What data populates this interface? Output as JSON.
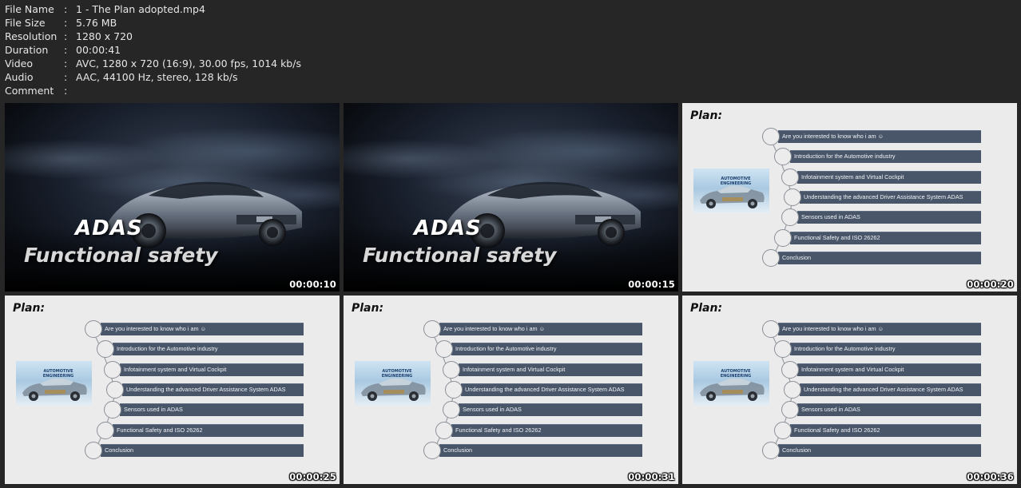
{
  "meta": [
    {
      "key": "File Name",
      "sep": ":",
      "value": "1 - The Plan adopted.mp4"
    },
    {
      "key": "File Size",
      "sep": ":",
      "value": "5.76 MB"
    },
    {
      "key": "Resolution",
      "sep": ":",
      "value": "1280 x 720"
    },
    {
      "key": "Duration",
      "sep": ":",
      "value": "00:00:41"
    },
    {
      "key": "Video",
      "sep": ":",
      "value": "AVC, 1280 x 720 (16:9), 30.00 fps, 1014 kb/s"
    },
    {
      "key": "Audio",
      "sep": ":",
      "value": "AAC, 44100 Hz, stereo, 128 kb/s"
    },
    {
      "key": "Comment",
      "sep": ":",
      "value": ""
    }
  ],
  "title_slide": {
    "line1": "ADAS",
    "line2": "Functional safety"
  },
  "plan_slide": {
    "title": "Plan:",
    "image_text": "AUTOMOTIVE ENGINEERING",
    "items": [
      "Are you interested to know who i am ☺",
      "Introduction for the Automotive industry",
      "Infotainment system and Virtual Cockpit",
      "Understanding the advanced Driver Assistance System ADAS",
      "Sensors used in ADAS",
      "Functional Safety and ISO 26262",
      "Conclusion"
    ]
  },
  "thumbnails": [
    {
      "type": "title",
      "timestamp": "00:00:10"
    },
    {
      "type": "title",
      "timestamp": "00:00:15"
    },
    {
      "type": "plan",
      "timestamp": "00:00:20"
    },
    {
      "type": "plan",
      "timestamp": "00:00:25"
    },
    {
      "type": "plan",
      "timestamp": "00:00:31"
    },
    {
      "type": "plan",
      "timestamp": "00:00:36"
    }
  ]
}
